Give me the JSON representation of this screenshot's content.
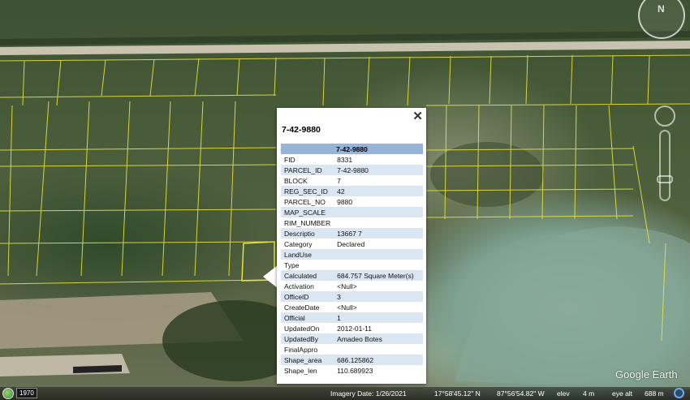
{
  "popup": {
    "title": "7-42-9880",
    "header": "7-42-9880",
    "close": "✕",
    "rows": [
      {
        "key": "FID",
        "value": "8331"
      },
      {
        "key": "PARCEL_ID",
        "value": "7-42-9880"
      },
      {
        "key": "BLOCK",
        "value": "7"
      },
      {
        "key": "REG_SEC_ID",
        "value": "42"
      },
      {
        "key": "PARCEL_NO",
        "value": "9880"
      },
      {
        "key": "MAP_SCALE",
        "value": ""
      },
      {
        "key": "RIM_NUMBER",
        "value": ""
      },
      {
        "key": "Descriptio",
        "value": "13667 7"
      },
      {
        "key": "Category",
        "value": "Declared"
      },
      {
        "key": "LandUse",
        "value": ""
      },
      {
        "key": "Type",
        "value": ""
      },
      {
        "key": "Calculated",
        "value": "684.757 Square Meter(s)"
      },
      {
        "key": "Activation",
        "value": "<Null>"
      },
      {
        "key": "OfficeID",
        "value": "3"
      },
      {
        "key": "CreateDate",
        "value": "<Null>"
      },
      {
        "key": "Official",
        "value": "1"
      },
      {
        "key": "UpdatedOn",
        "value": "2012-01-11"
      },
      {
        "key": "UpdatedBy",
        "value": "Amadeo Botes"
      },
      {
        "key": "FinalAppro",
        "value": ""
      },
      {
        "key": "Shape_area",
        "value": "686.125862"
      },
      {
        "key": "Shape_len",
        "value": "110.689923"
      }
    ]
  },
  "status": {
    "year": "1970",
    "imagery_date": "Imagery Date: 1/26/2021",
    "lat": "17°58'45.12\" N",
    "lon": "87°56'54.82\" W",
    "elev_label": "elev",
    "elev_value": "4 m",
    "eye_alt_label": "eye alt",
    "eye_alt_value": "688 m"
  },
  "watermark": "Google Earth",
  "compass_label": "N",
  "colors": {
    "parcel_lines": "#e8e23a",
    "popup_header": "#96b4d8",
    "popup_alt_row": "#dbe6f3"
  }
}
